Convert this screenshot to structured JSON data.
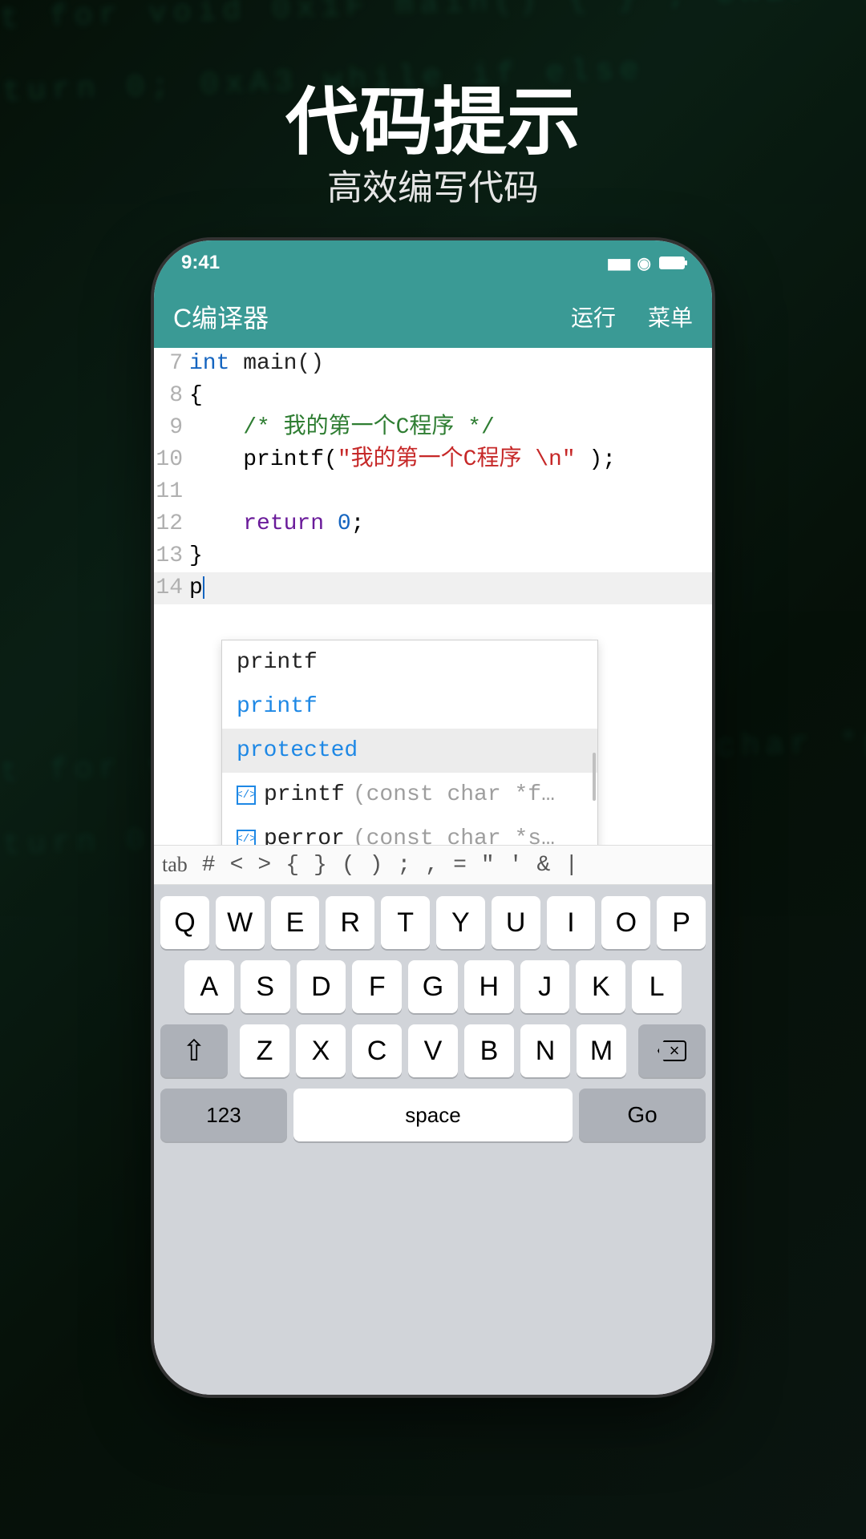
{
  "hero": {
    "title": "代码提示",
    "subtitle": "高效编写代码"
  },
  "statusbar": {
    "time": "9:41"
  },
  "header": {
    "title": "C编译器",
    "run": "运行",
    "menu": "菜单"
  },
  "code": {
    "line7": {
      "num": "7",
      "type": "int",
      "func": " main()"
    },
    "line8": {
      "num": "8",
      "text": "{"
    },
    "line9": {
      "num": "9",
      "comment": "/* 我的第一个C程序 */"
    },
    "line10": {
      "num": "10",
      "call": "printf(",
      "str": "\"我的第一个C程序 \\n\"",
      "tail": " );"
    },
    "line11": {
      "num": "11"
    },
    "line12": {
      "num": "12",
      "kw": "return",
      "val": " 0",
      "semi": ";"
    },
    "line13": {
      "num": "13",
      "text": "}"
    },
    "line14": {
      "num": "14",
      "typed": "p"
    }
  },
  "autocomplete": {
    "items": [
      {
        "label": "printf",
        "style": "plain"
      },
      {
        "label": "printf",
        "style": "blue"
      },
      {
        "label": "protected",
        "style": "blue selected"
      },
      {
        "icon": true,
        "label": "printf",
        "param": "(const char *f…"
      },
      {
        "icon": true,
        "label": "perror",
        "param": "(const char *s…"
      }
    ]
  },
  "symbols": [
    "tab",
    "#",
    "<",
    ">",
    "{",
    "}",
    "(",
    ")",
    ";",
    ",",
    "=",
    "\"",
    "'",
    "&",
    "|"
  ],
  "keyboard": {
    "row1": [
      "Q",
      "W",
      "E",
      "R",
      "T",
      "Y",
      "U",
      "I",
      "O",
      "P"
    ],
    "row2": [
      "A",
      "S",
      "D",
      "F",
      "G",
      "H",
      "J",
      "K",
      "L"
    ],
    "row3": [
      "Z",
      "X",
      "C",
      "V",
      "B",
      "N",
      "M"
    ],
    "numKey": "123",
    "spaceKey": "space",
    "goKey": "Go"
  }
}
